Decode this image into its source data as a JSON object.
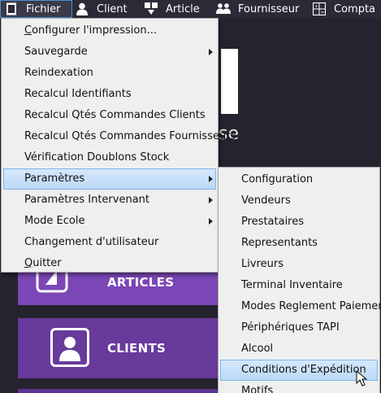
{
  "menubar": {
    "items": [
      {
        "label": "Fichier",
        "icon": "document-icon"
      },
      {
        "label": "Client",
        "icon": "person-icon"
      },
      {
        "label": "Article",
        "icon": "article-icon"
      },
      {
        "label": "Fournisseur",
        "icon": "people-icon"
      },
      {
        "label": "Compta",
        "icon": "calculator-icon"
      }
    ]
  },
  "background": {
    "heading_fragment": "se",
    "tiles": [
      {
        "label": "ARTICLES"
      },
      {
        "label": "CLIENTS"
      }
    ]
  },
  "fichier_menu": {
    "items": [
      {
        "label_prefix": "",
        "label_accel": "C",
        "label_rest": "onfigurer l'impression...",
        "has_submenu": false
      },
      {
        "label": "Sauvegarde",
        "has_submenu": true
      },
      {
        "label": "Reindexation",
        "has_submenu": false
      },
      {
        "label": "Recalcul Identifiants",
        "has_submenu": false
      },
      {
        "label": "Recalcul Qtés Commandes Clients",
        "has_submenu": false
      },
      {
        "label": "Recalcul Qtés Commandes Fournisseurs",
        "has_submenu": false
      },
      {
        "label": "Vérification Doublons Stock",
        "has_submenu": false
      },
      {
        "label": "Paramètres",
        "has_submenu": true,
        "active": true
      },
      {
        "label": "Paramètres Intervenant",
        "has_submenu": true
      },
      {
        "label": "Mode Ecole",
        "has_submenu": true
      },
      {
        "label": "Changement d'utilisateur",
        "has_submenu": false
      },
      {
        "label_accel": "Q",
        "label_rest": "uitter",
        "has_submenu": false
      }
    ]
  },
  "parametres_submenu": {
    "items": [
      {
        "label": "Configuration"
      },
      {
        "label": "Vendeurs"
      },
      {
        "label": "Prestataires"
      },
      {
        "label": "Representants"
      },
      {
        "label": "Livreurs"
      },
      {
        "label": "Terminal Inventaire"
      },
      {
        "label": "Modes Reglement Paiement"
      },
      {
        "label": "Périphériques TAPI"
      },
      {
        "label": "Alcool"
      },
      {
        "label": "Conditions d'Expédition",
        "active": true
      },
      {
        "label": "Motifs"
      }
    ]
  },
  "colors": {
    "background": "#25232e",
    "menubar": "#2c2a36",
    "tile_purple": "#7b46b6",
    "menu_bg": "#efefef",
    "highlight": "#bcd9f7"
  }
}
